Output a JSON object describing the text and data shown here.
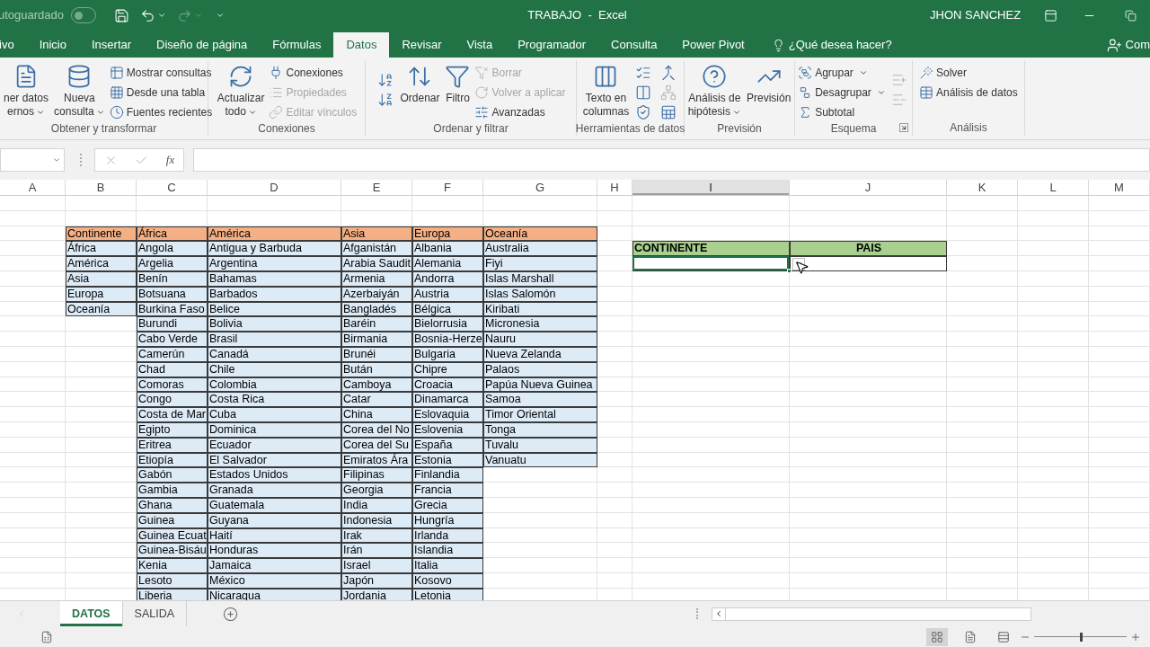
{
  "title_bar": {
    "autosave_label": "utoguardado",
    "autosave_on": false,
    "title": "TRABAJO  -  Excel",
    "user": "JHON SANCHEZ"
  },
  "ribbon_tabs": [
    {
      "label": "ivo",
      "selected": false
    },
    {
      "label": "Inicio",
      "selected": false
    },
    {
      "label": "Insertar",
      "selected": false
    },
    {
      "label": "Diseño de página",
      "selected": false
    },
    {
      "label": "Fórmulas",
      "selected": false
    },
    {
      "label": "Datos",
      "selected": true
    },
    {
      "label": "Revisar",
      "selected": false
    },
    {
      "label": "Vista",
      "selected": false
    },
    {
      "label": "Programador",
      "selected": false
    },
    {
      "label": "Consulta",
      "selected": false
    },
    {
      "label": "Power Pivot",
      "selected": false
    }
  ],
  "tell_me": "¿Qué desea hacer?",
  "share": "Com",
  "ribbon_groups": [
    {
      "label": "Obtener y transformar",
      "launcher": false,
      "controls": [
        {
          "kind": "large",
          "lines": [
            "ner datos",
            "ernos"
          ],
          "dropdown": true
        },
        {
          "kind": "large",
          "lines": [
            "Nueva",
            "consulta"
          ],
          "dropdown": true
        },
        {
          "kind": "smalls",
          "items": [
            {
              "label": "Mostrar consultas",
              "disabled": false,
              "dropdown": false
            },
            {
              "label": "Desde una tabla",
              "disabled": false,
              "dropdown": false
            },
            {
              "label": "Fuentes recientes",
              "disabled": false,
              "dropdown": false
            }
          ]
        }
      ]
    },
    {
      "label": "Conexiones",
      "launcher": false,
      "controls": [
        {
          "kind": "large",
          "lines": [
            "Actualizar",
            "todo"
          ],
          "dropdown": true
        },
        {
          "kind": "smalls",
          "items": [
            {
              "label": "Conexiones",
              "disabled": false,
              "dropdown": false
            },
            {
              "label": "Propiedades",
              "disabled": true,
              "dropdown": false
            },
            {
              "label": "Editar vínculos",
              "disabled": true,
              "dropdown": false
            }
          ]
        }
      ]
    },
    {
      "label": "Ordenar y filtrar",
      "launcher": false,
      "controls": [
        {
          "kind": "sort-buttons"
        },
        {
          "kind": "large",
          "lines": [
            "Ordenar"
          ],
          "dropdown": false
        },
        {
          "kind": "large",
          "lines": [
            "Filtro"
          ],
          "dropdown": false
        },
        {
          "kind": "smalls",
          "items": [
            {
              "label": "Borrar",
              "disabled": true,
              "dropdown": false
            },
            {
              "label": "Volver a aplicar",
              "disabled": true,
              "dropdown": false
            },
            {
              "label": "Avanzadas",
              "disabled": false,
              "dropdown": false
            }
          ]
        }
      ]
    },
    {
      "label": "Herramientas de datos",
      "launcher": false,
      "controls": [
        {
          "kind": "large",
          "lines": [
            "Texto en",
            "columnas"
          ],
          "dropdown": false
        },
        {
          "kind": "data-tools"
        }
      ]
    },
    {
      "label": "Previsión",
      "launcher": false,
      "controls": [
        {
          "kind": "large",
          "lines": [
            "Análisis de",
            "hipótesis"
          ],
          "dropdown": true
        },
        {
          "kind": "large",
          "lines": [
            "Previsión"
          ],
          "dropdown": false
        }
      ]
    },
    {
      "label": "Esquema",
      "launcher": true,
      "controls": [
        {
          "kind": "smalls",
          "items": [
            {
              "label": "Agrupar",
              "disabled": false,
              "dropdown": true
            },
            {
              "label": "Desagrupar",
              "disabled": false,
              "dropdown": true
            },
            {
              "label": "Subtotal",
              "disabled": false,
              "dropdown": false
            }
          ]
        },
        {
          "kind": "outline-detail"
        }
      ]
    },
    {
      "label": "Análisis",
      "launcher": false,
      "controls": [
        {
          "kind": "smalls",
          "items": [
            {
              "label": "Solver",
              "disabled": false,
              "dropdown": false
            },
            {
              "label": "Análisis de datos",
              "disabled": false,
              "dropdown": false
            }
          ]
        }
      ]
    }
  ],
  "formula_bar": {
    "function_label": "fx"
  },
  "columns": [
    {
      "label": "A",
      "selected": false
    },
    {
      "label": "B",
      "selected": false
    },
    {
      "label": "C",
      "selected": false
    },
    {
      "label": "D",
      "selected": false
    },
    {
      "label": "E",
      "selected": false
    },
    {
      "label": "F",
      "selected": false
    },
    {
      "label": "G",
      "selected": false
    },
    {
      "label": "H",
      "selected": false
    },
    {
      "label": "I",
      "selected": true
    },
    {
      "label": "J",
      "selected": false
    },
    {
      "label": "K",
      "selected": false
    },
    {
      "label": "L",
      "selected": false
    },
    {
      "label": "M",
      "selected": false
    }
  ],
  "country_table": {
    "headers": [
      "Continente",
      "África",
      "América",
      "Asia",
      "Europa",
      "Oceanía"
    ],
    "columns": [
      [
        "África",
        "América",
        "Asia",
        "Europa",
        "Oceanía"
      ],
      [
        "Angola",
        "Argelia",
        "Benín",
        "Botsuana",
        "Burkina Faso",
        "Burundi",
        "Cabo Verde",
        "Camerún",
        "Chad",
        "Comoras",
        "Congo",
        "Costa de Mar",
        "Egipto",
        "Eritrea",
        "Etiopía",
        "Gabón",
        "Gambia",
        "Ghana",
        "Guinea",
        "Guinea Ecuat",
        "Guinea-Bisáu",
        "Kenia",
        "Lesoto",
        "Liberia"
      ],
      [
        "Antigua y Barbuda",
        "Argentina",
        "Bahamas",
        "Barbados",
        "Belice",
        "Bolivia",
        "Brasil",
        "Canadá",
        "Chile",
        "Colombia",
        "Costa Rica",
        "Cuba",
        "Dominica",
        "Ecuador",
        "El Salvador",
        "Estados Unidos",
        "Granada",
        "Guatemala",
        "Guyana",
        "Haití",
        "Honduras",
        "Jamaica",
        "México",
        "Nicaragua"
      ],
      [
        "Afganistán",
        "Arabia Saudit",
        "Armenia",
        "Azerbaiyán",
        "Bangladés",
        "Baréin",
        "Birmania",
        "Brunéi",
        "Bután",
        "Camboya",
        "Catar",
        "China",
        "Corea del No",
        "Corea del Su",
        "Emiratos Ára",
        "Filipinas",
        "Georgia",
        "India",
        "Indonesia",
        "Irak",
        "Irán",
        "Israel",
        "Japón",
        "Jordania"
      ],
      [
        "Albania",
        "Alemania",
        "Andorra",
        "Austria",
        "Bélgica",
        "Bielorrusia",
        "Bosnia-Herze",
        "Bulgaria",
        "Chipre",
        "Croacia",
        "Dinamarca",
        "Eslovaquia",
        "Eslovenia",
        "España",
        "Estonia",
        "Finlandia",
        "Francia",
        "Grecia",
        "Hungría",
        "Irlanda",
        "Islandia",
        "Italia",
        "Kosovo",
        "Letonia"
      ],
      [
        "Australia",
        "Fiyi",
        "Islas Marshall",
        "Islas Salomón",
        "Kiribati",
        "Micronesia",
        "Nauru",
        "Nueva Zelanda",
        "Palaos",
        "Papúa Nueva Guinea",
        "Samoa",
        "Timor Oriental",
        "Tonga",
        "Tuvalu",
        "Vanuatu"
      ]
    ]
  },
  "selection_table": {
    "headers": [
      "CONTINENTE",
      "PAIS"
    ],
    "entry_cells": [
      {
        "selected": true
      },
      {
        "selected": false
      }
    ],
    "validation_button": true
  },
  "sheet_tabs": [
    {
      "label": "DATOS",
      "selected": true
    },
    {
      "label": "SALIDA",
      "selected": false
    }
  ],
  "status_bar": {
    "views": [
      {
        "selected": true
      },
      {
        "selected": false
      },
      {
        "selected": false
      }
    ],
    "zoom": {
      "level": 0.5
    }
  }
}
